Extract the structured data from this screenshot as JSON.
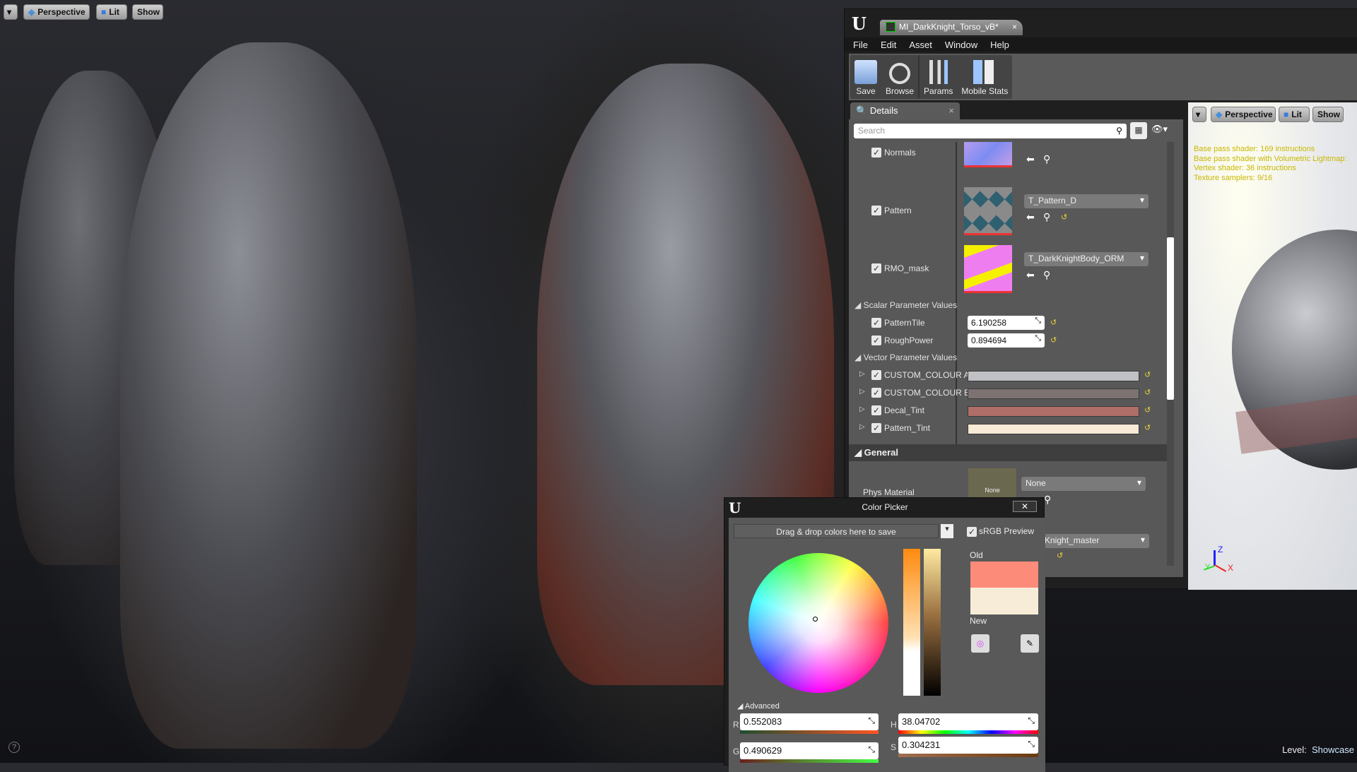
{
  "viewport": {
    "dropdown_icon": "chevron-down-icon",
    "perspective": "Perspective",
    "lit": "Lit",
    "show": "Show",
    "level_label": "Level:",
    "level_name": "Showcase",
    "help_icon": "question-icon"
  },
  "editor": {
    "logo": "unreal-logo",
    "tab_title": "MI_DarkKnight_Torso_vB*",
    "menu": [
      "File",
      "Edit",
      "Asset",
      "Window",
      "Help"
    ],
    "toolbar": [
      {
        "label": "Save",
        "icon": "save-icon"
      },
      {
        "label": "Browse",
        "icon": "browse-icon"
      },
      {
        "label": "Params",
        "icon": "params-icon"
      },
      {
        "label": "Mobile Stats",
        "icon": "mobile-stats-icon"
      }
    ],
    "details": {
      "tab": "Details",
      "search_placeholder": "Search",
      "textures": [
        {
          "name": "Normals",
          "checked": true
        },
        {
          "name": "Pattern",
          "checked": true,
          "value": "T_Pattern_D"
        },
        {
          "name": "RMO_mask",
          "checked": true,
          "value": "T_DarkKnightBody_ORM"
        }
      ],
      "scalar_header": "Scalar Parameter Values",
      "scalars": [
        {
          "name": "PatternTile",
          "value": "6.190258"
        },
        {
          "name": "RoughPower",
          "value": "0.894694"
        }
      ],
      "vector_header": "Vector Parameter Values",
      "vectors": [
        {
          "name": "CUSTOM_COLOUR A",
          "color": "#c0c1c5"
        },
        {
          "name": "CUSTOM_COLOUR B",
          "color": "#7c7271"
        },
        {
          "name": "Decal_Tint",
          "color": "#b06e68"
        },
        {
          "name": "Pattern_Tint",
          "color": "#f7ead6"
        }
      ],
      "general_header": "General",
      "phys_material_label": "Phys Material",
      "phys_material_thumb": "None",
      "phys_material_value": "None",
      "parent_value": "kKnight_master"
    },
    "preview": {
      "perspective": "Perspective",
      "lit": "Lit",
      "show": "Show",
      "stats": [
        "Base pass shader: 169 instructions",
        "Base pass shader with Volumetric Lightmap:",
        "Vertex shader: 36 instructions",
        "Texture samplers: 9/16"
      ],
      "axis": {
        "x": "X",
        "y": "Y",
        "z": "Z"
      }
    }
  },
  "color_picker": {
    "title": "Color Picker",
    "close": "✕",
    "save_area": "Drag & drop colors here to save",
    "srgb_label": "sRGB Preview",
    "srgb_checked": true,
    "old_label": "Old",
    "new_label": "New",
    "old_color": "#fd8b7a",
    "new_color": "#f7ecd8",
    "advanced": "Advanced",
    "r_label": "R",
    "r": "0.552083",
    "g_label": "G",
    "g": "0.490629",
    "h_label": "H",
    "h": "38.04702",
    "s_label": "S",
    "s": "0.304231"
  }
}
